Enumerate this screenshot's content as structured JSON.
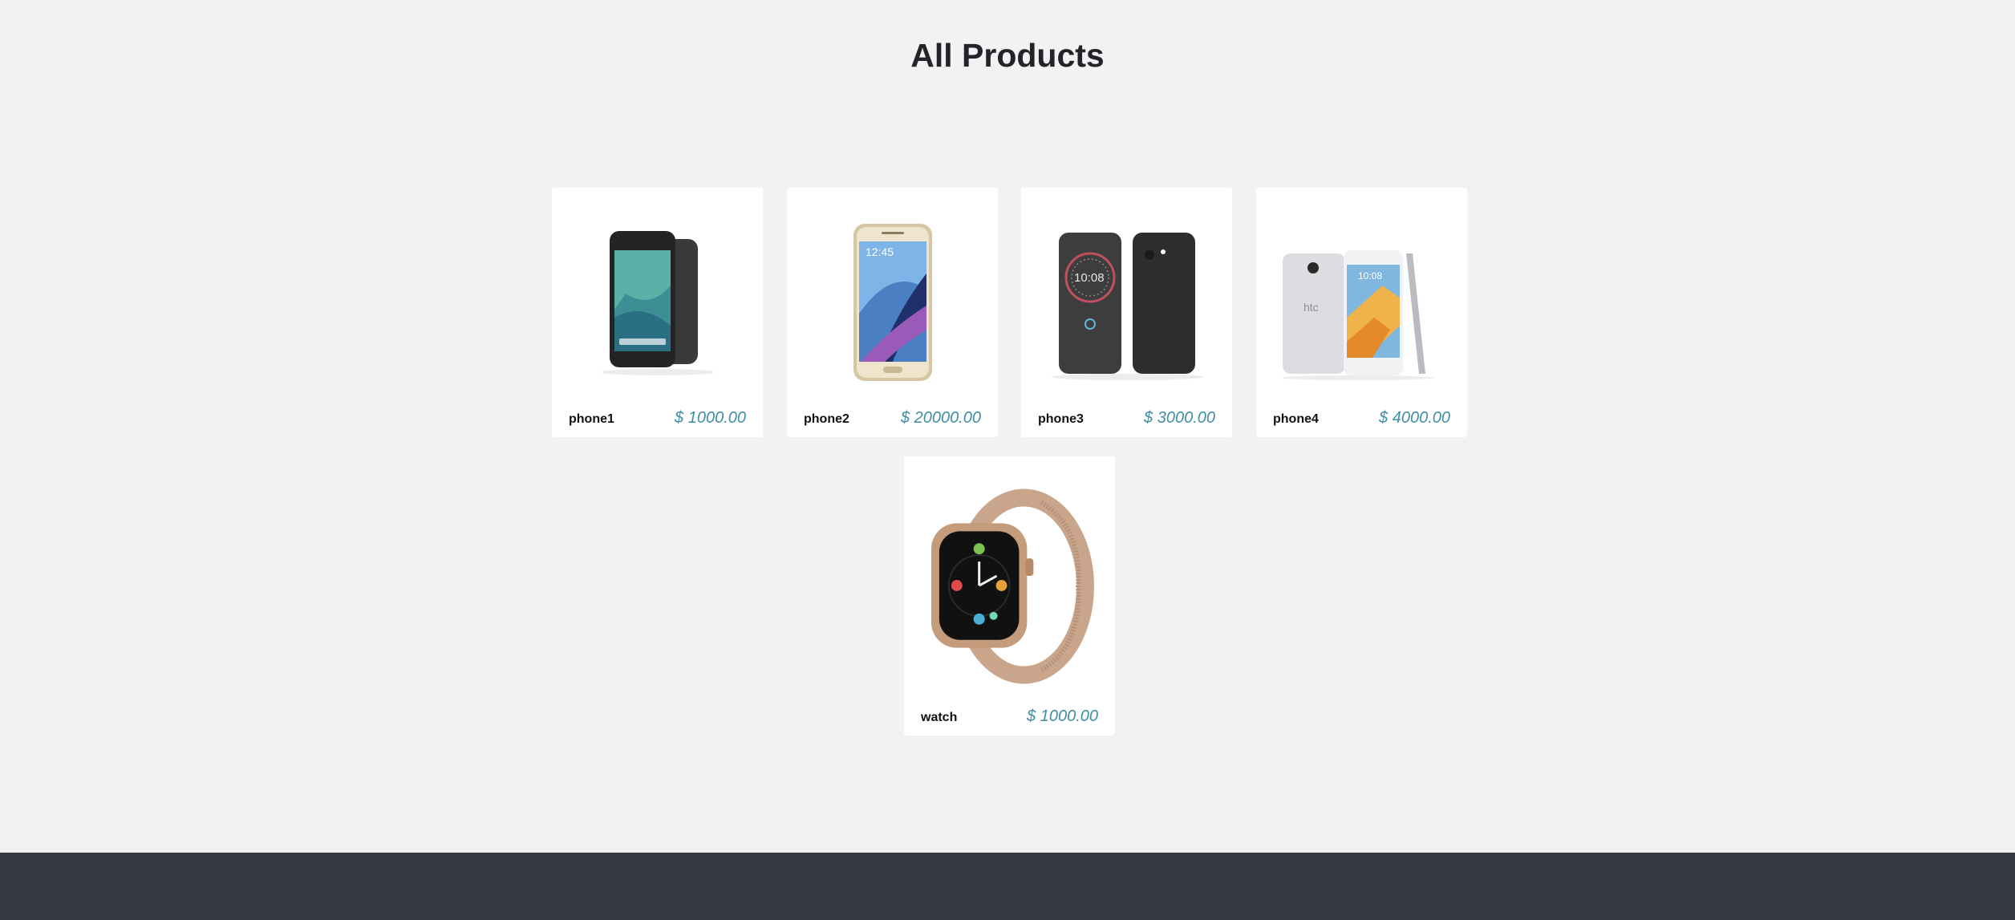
{
  "page": {
    "title": "All Products"
  },
  "products": [
    {
      "name": "phone1",
      "price": "$ 1000.00",
      "image": "pixel-phone-image"
    },
    {
      "name": "phone2",
      "price": "$ 20000.00",
      "image": "galaxy-note-phone-image"
    },
    {
      "name": "phone3",
      "price": "$ 3000.00",
      "image": "htc-flip-case-phone-image"
    },
    {
      "name": "phone4",
      "price": "$ 4000.00",
      "image": "htc-10-phone-image"
    },
    {
      "name": "watch",
      "price": "$ 1000.00",
      "image": "smart-watch-image"
    }
  ],
  "colors": {
    "background": "#f2f2f2",
    "card": "#ffffff",
    "price": "#3f8ea6",
    "footer": "#343a40"
  }
}
